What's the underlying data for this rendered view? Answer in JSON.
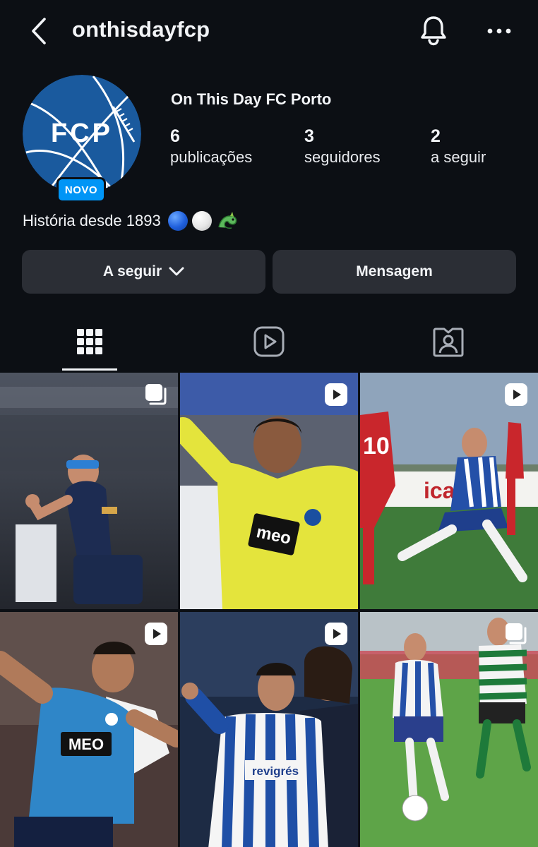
{
  "header": {
    "username": "onthisdayfcp",
    "back_icon": "chevron-left-icon",
    "bell_icon": "bell-icon",
    "more_icon": "more-horizontal-icon"
  },
  "profile": {
    "avatar_text": "FCP",
    "badge": "NOVO",
    "display_name": "On This Day FC Porto",
    "stats": {
      "posts": {
        "value": "6",
        "label": "publicações"
      },
      "followers": {
        "value": "3",
        "label": "seguidores"
      },
      "following": {
        "value": "2",
        "label": "a seguir"
      }
    },
    "bio": "História desde 1893",
    "bio_emojis": [
      "blue-circle",
      "white-circle",
      "dragon"
    ]
  },
  "actions": {
    "follow_label": "A seguir",
    "message_label": "Mensagem"
  },
  "tabs": [
    {
      "name": "posts",
      "icon": "grid-icon",
      "active": true
    },
    {
      "name": "reels",
      "icon": "reels-icon",
      "active": false
    },
    {
      "name": "tagged",
      "icon": "tagged-icon",
      "active": false
    }
  ],
  "posts": [
    {
      "type": "carousel",
      "icon": "carousel-icon"
    },
    {
      "type": "reel",
      "icon": "reel-icon",
      "shirt_text": "meo"
    },
    {
      "type": "reel",
      "icon": "reel-icon",
      "banner_text": "icar",
      "shirt_number": "10"
    },
    {
      "type": "reel",
      "icon": "reel-icon",
      "shirt_text": "MEO"
    },
    {
      "type": "reel",
      "icon": "reel-icon",
      "shirt_text": "revigrés"
    },
    {
      "type": "carousel",
      "icon": "carousel-icon"
    }
  ],
  "colors": {
    "background": "#0c0f14",
    "button": "#2b2e35",
    "badge": "#0095f6",
    "porto_blue": "#1a5a9e"
  }
}
